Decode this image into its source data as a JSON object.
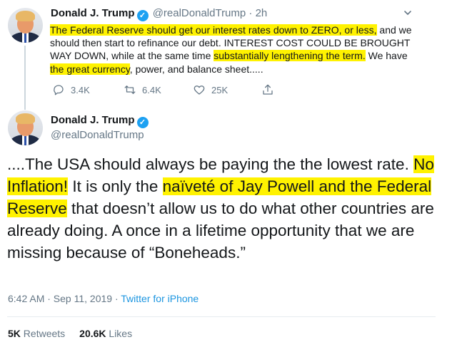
{
  "tweet1": {
    "display_name": "Donald J. Trump",
    "handle": "@realDonaldTrump",
    "separator": "·",
    "time": "2h",
    "text_segments": [
      {
        "text": "The Federal Reserve should get our interest rates down to ZERO, or less,",
        "highlight": true
      },
      {
        "text": " and we should then start to refinance our debt. INTEREST COST COULD BE BROUGHT WAY DOWN, while at the same time ",
        "highlight": false
      },
      {
        "text": "substantially lengthening the term.",
        "highlight": true
      },
      {
        "text": " We have ",
        "highlight": false
      },
      {
        "text": "the great currency",
        "highlight": true
      },
      {
        "text": ", power, and balance sheet.....",
        "highlight": false
      }
    ],
    "actions": {
      "replies": "3.4K",
      "retweets": "6.4K",
      "likes": "25K"
    }
  },
  "tweet2": {
    "display_name": "Donald J. Trump",
    "handle": "@realDonaldTrump",
    "text_segments": [
      {
        "text": "....The USA should always be paying the the lowest rate. ",
        "highlight": false
      },
      {
        "text": "No Inflation!",
        "highlight": true
      },
      {
        "text": " It is only the ",
        "highlight": false
      },
      {
        "text": "naïveté of Jay Powell and the Federal Reserve",
        "highlight": true
      },
      {
        "text": " that doesn’t allow us to do what other countries are already doing. A once in a lifetime opportunity that we are missing because of “Boneheads.”",
        "highlight": false
      }
    ],
    "timestamp": "6:42 AM · Sep 11, 2019",
    "meta_separator": " · ",
    "source": "Twitter for iPhone",
    "retweets_count": "5K",
    "retweets_label": "Retweets",
    "likes_count": "20.6K",
    "likes_label": "Likes"
  },
  "colors": {
    "highlight": "#fff200",
    "twitter_blue": "#1da1f2",
    "muted": "#657786"
  },
  "icons": {
    "verified": "verified-badge-icon",
    "caret": "chevron-down-icon",
    "reply": "reply-icon",
    "retweet": "retweet-icon",
    "like": "heart-icon",
    "share": "share-icon"
  }
}
